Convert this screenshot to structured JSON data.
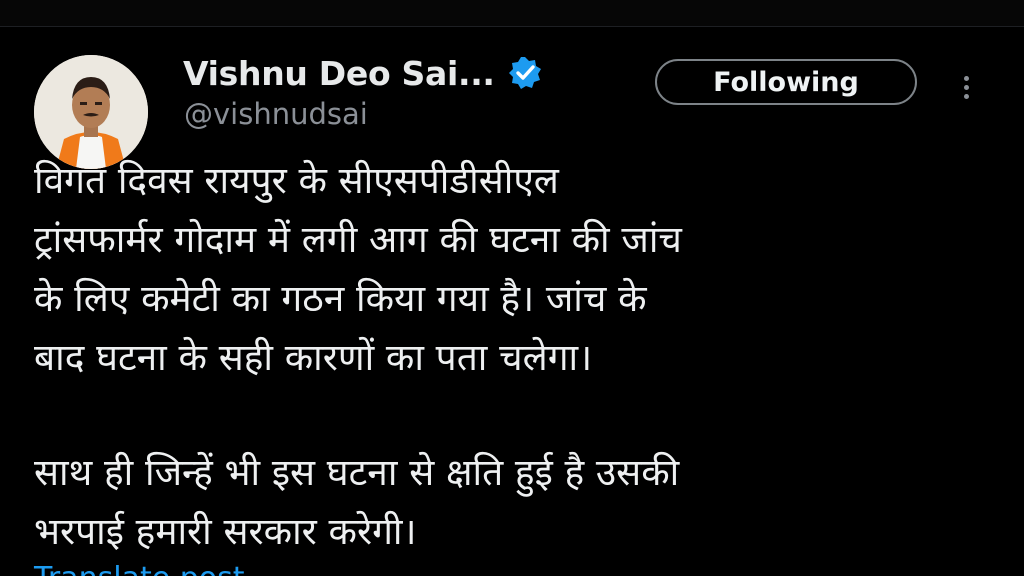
{
  "tweet": {
    "author": {
      "name": "Vishnu Deo Sai...",
      "handle": "@vishnudsai",
      "verified": true,
      "avatar_icon": "profile-photo"
    },
    "follow_button_label": "Following",
    "more_icon": "more-options-icon",
    "paragraphs": [
      "विगत दिवस रायपुर के सीएसपीडीसीएल\nट्रांसफार्मर गोदाम में लगी आग की घटना की जांच\nके लिए कमेटी का गठन किया गया है। जांच के\nबाद घटना के सही कारणों का पता चलेगा।",
      "साथ ही जिन्हें भी इस घटना से क्षति हुई है उसकी\nभरपाई हमारी सरकार करेगी।"
    ],
    "translate_label": "Translate post"
  },
  "colors": {
    "background": "#000000",
    "text": "#e7e9ea",
    "secondary_text": "#8b9097",
    "accent_blue": "#1d9bf0",
    "button_border": "#7d8388"
  }
}
